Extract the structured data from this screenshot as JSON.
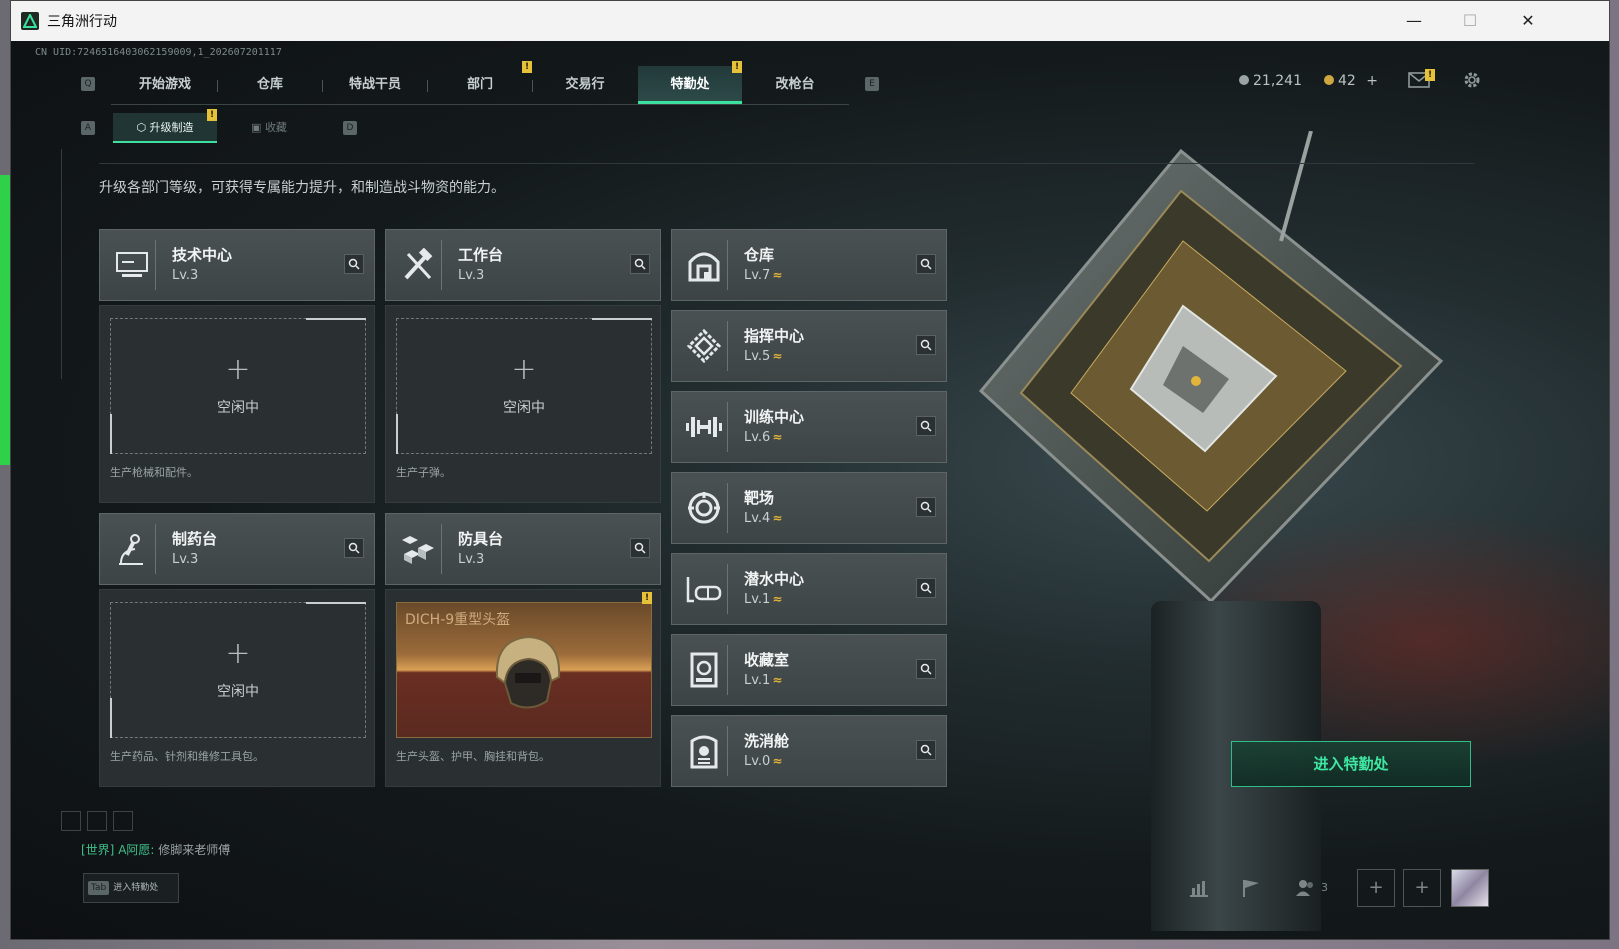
{
  "window": {
    "title": "三角洲行动",
    "min_label": "—",
    "max_label": "☐",
    "close_label": "✕"
  },
  "uid": "CN UID:7246516403062159009,1_202607201117",
  "tabs": [
    {
      "label": "开始游戏",
      "active": false
    },
    {
      "label": "仓库",
      "active": false
    },
    {
      "label": "特战干员",
      "active": false
    },
    {
      "label": "部门",
      "active": false,
      "badge": "!"
    },
    {
      "label": "交易行",
      "active": false
    },
    {
      "label": "特勤处",
      "active": true,
      "badge": "!"
    },
    {
      "label": "改枪台",
      "active": false
    }
  ],
  "key_hints": {
    "tab_left": "Q",
    "tab_right": "E",
    "sub_left": "A",
    "sub_right": "D"
  },
  "currencies": [
    {
      "value": "21,241",
      "color": "#9aa4a6"
    },
    {
      "value": "42",
      "color": "#d0a640",
      "plus": "+"
    }
  ],
  "subtabs": [
    {
      "label": "升级制造",
      "active": true,
      "badge": "!"
    },
    {
      "label": "收藏",
      "active": false
    }
  ],
  "description": "升级各部门等级，可获得专属能力提升，和制造战斗物资的能力。",
  "production": [
    {
      "name": "技术中心",
      "level": "Lv.3",
      "icon": "computer-icon",
      "status": "空闲中",
      "hint": "生产枪械和配件。"
    },
    {
      "name": "工作台",
      "level": "Lv.3",
      "icon": "tools-icon",
      "status": "空闲中",
      "hint": "生产子弹。"
    },
    {
      "name": "制药台",
      "level": "Lv.3",
      "icon": "microscope-icon",
      "status": "空闲中",
      "hint": "生产药品、针剂和维修工具包。"
    },
    {
      "name": "防具台",
      "level": "Lv.3",
      "icon": "armor-icon",
      "item": "DICH-9重型头盔",
      "hint": "生产头盔、护甲、胸挂和背包。"
    }
  ],
  "departments": [
    {
      "name": "仓库",
      "level": "Lv.7",
      "icon": "warehouse-icon"
    },
    {
      "name": "指挥中心",
      "level": "Lv.5",
      "icon": "command-icon"
    },
    {
      "name": "训练中心",
      "level": "Lv.6",
      "icon": "dumbbell-icon"
    },
    {
      "name": "靶场",
      "level": "Lv.4",
      "icon": "target-icon"
    },
    {
      "name": "潜水中心",
      "level": "Lv.1",
      "icon": "dive-icon"
    },
    {
      "name": "收藏室",
      "level": "Lv.1",
      "icon": "collection-icon"
    },
    {
      "name": "洗消舱",
      "level": "Lv.0",
      "icon": "decon-icon"
    }
  ],
  "upgrade_marker": "≈",
  "enter_button": "进入特勤处",
  "chat": {
    "channel": "[世界]",
    "user": "A阿愿:",
    "message": "修脚来老师傅"
  },
  "tab_hint": {
    "key": "Tab",
    "label": "进入特勤处"
  },
  "friends_count": "3",
  "colors": {
    "accent": "#3ee0a0",
    "badge": "#e6c13a",
    "upgrade": "#e3b43a"
  }
}
